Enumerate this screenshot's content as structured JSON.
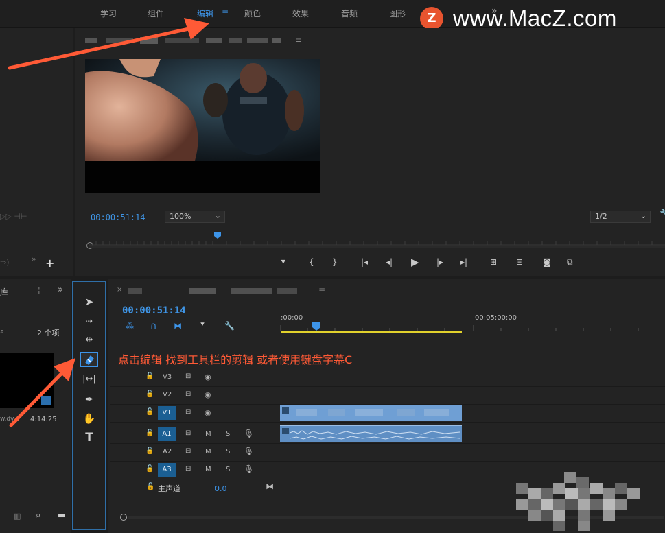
{
  "workspaces": [
    "学习",
    "组件",
    "编辑",
    "颜色",
    "效果",
    "音频",
    "图形"
  ],
  "workspace_active": "编辑",
  "workspace_menu_icon": "≡",
  "workspace_overflow": "»",
  "watermark": {
    "text": "www.MacZ.com",
    "logo_letter": "Z",
    "logo_color": "#e8542f"
  },
  "program_monitor": {
    "menu_icon": "≡",
    "timecode": "00:00:51:14",
    "zoom": "100%",
    "resolution": "1/2"
  },
  "project_panel": {
    "title": "库",
    "count": "2 个项",
    "item_duration": "4:14:25",
    "item_name": "w.dv..."
  },
  "timeline": {
    "close": "×",
    "menu_icon": "≡",
    "timecode": "00:00:51:14",
    "ruler_start": ":00:00",
    "ruler_mid": "00:05:00:00",
    "tracks": [
      {
        "name": "V3",
        "type": "video",
        "on": false
      },
      {
        "name": "V2",
        "type": "video",
        "on": false
      },
      {
        "name": "V1",
        "type": "video",
        "on": true
      },
      {
        "name": "A1",
        "type": "audio",
        "on": true
      },
      {
        "name": "A2",
        "type": "audio",
        "on": false
      },
      {
        "name": "A3",
        "type": "audio",
        "on": true
      }
    ],
    "mute": "M",
    "solo": "S",
    "master_label": "主声道",
    "master_value": "0.0"
  },
  "annotation": "点击编辑 找到工具栏的剪辑 或者使用键盘字幕C",
  "colors": {
    "accent": "#3d94e8",
    "annotation": "#ff5a36",
    "clip_video": "#6f9fd4",
    "clip_audio": "#5f8fc4",
    "highlight_box": "#2f6fa8"
  }
}
